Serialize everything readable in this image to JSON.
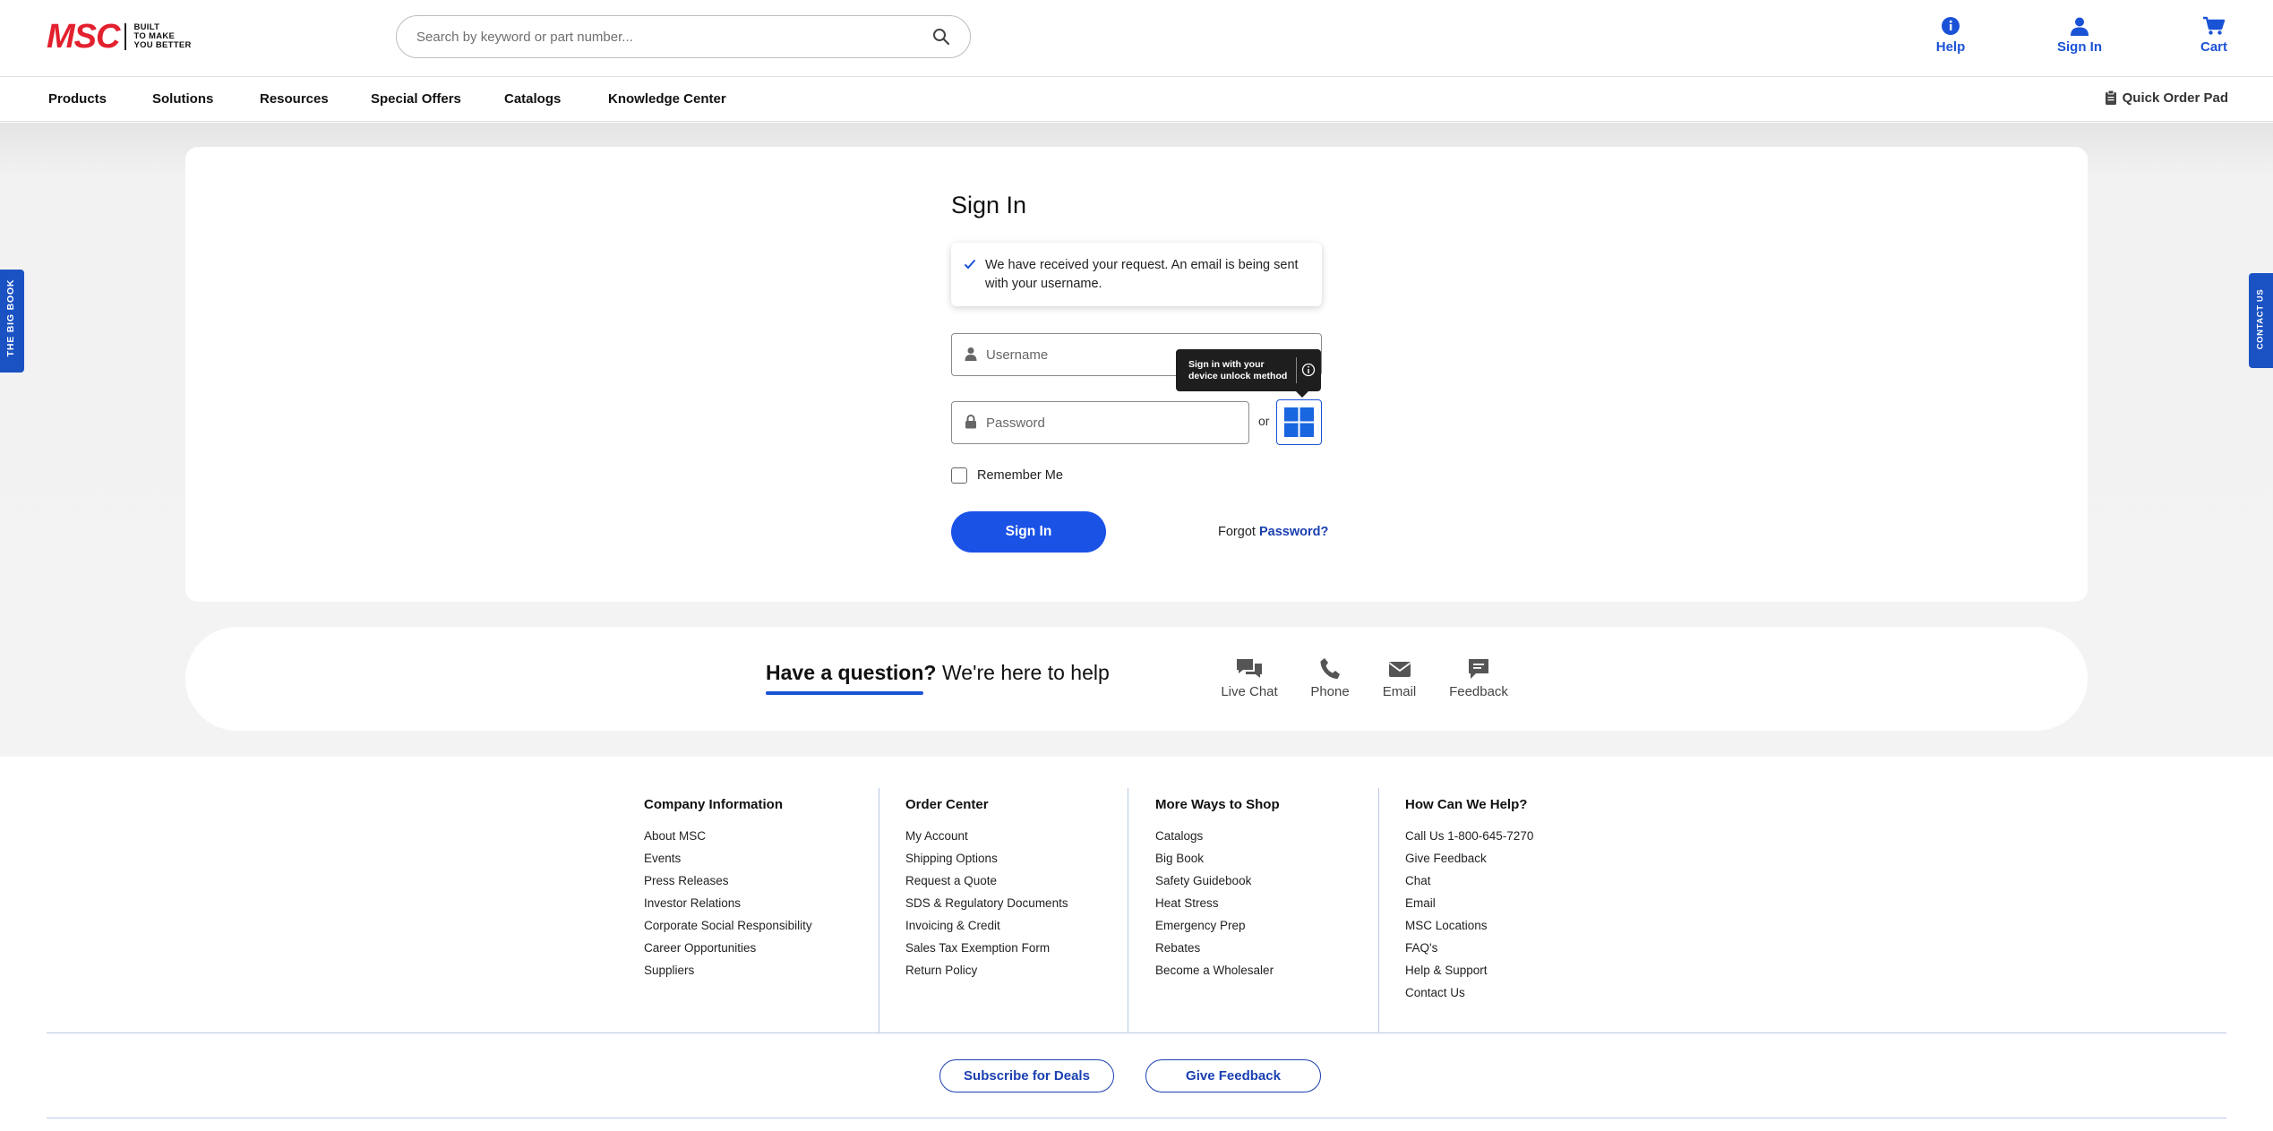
{
  "brand": {
    "name": "MSC",
    "tagline": [
      "BUILT",
      "TO MAKE",
      "YOU BETTER"
    ],
    "accent": "#1a52d6",
    "logo_red": "#e3202e"
  },
  "search": {
    "placeholder": "Search by keyword or part number..."
  },
  "header_actions": {
    "help": "Help",
    "sign_in": "Sign In",
    "cart": "Cart"
  },
  "nav": {
    "items": [
      "Products",
      "Solutions",
      "Resources",
      "Special Offers",
      "Catalogs",
      "Knowledge Center"
    ],
    "quick_order": "Quick Order Pad"
  },
  "signin": {
    "title": "Sign In",
    "alert": "We have received your request. An email is being sent with your username.",
    "username_placeholder": "Username",
    "password_placeholder": "Password",
    "or": "or",
    "tooltip": "Sign in with your device unlock method",
    "remember": "Remember Me",
    "button": "Sign In",
    "forgot_prefix": "Forgot",
    "forgot_link": "Password?"
  },
  "help_band": {
    "heading": "Have a question?",
    "subheading": "We're here to help",
    "options": [
      "Live Chat",
      "Phone",
      "Email",
      "Feedback"
    ]
  },
  "footer": {
    "columns": [
      {
        "title": "Company Information",
        "links": [
          "About MSC",
          "Events",
          "Press Releases",
          "Investor Relations",
          "Corporate Social Responsibility",
          "Career Opportunities",
          "Suppliers"
        ]
      },
      {
        "title": "Order Center",
        "links": [
          "My Account",
          "Shipping Options",
          "Request a Quote",
          "SDS & Regulatory Documents",
          "Invoicing & Credit",
          "Sales Tax Exemption Form",
          "Return Policy"
        ]
      },
      {
        "title": "More Ways to Shop",
        "links": [
          "Catalogs",
          "Big Book",
          "Safety Guidebook",
          "Heat Stress",
          "Emergency Prep",
          "Rebates",
          "Become a Wholesaler"
        ]
      },
      {
        "title": "How Can We Help?",
        "links": [
          "Call Us 1-800-645-7270",
          "Give Feedback",
          "Chat",
          "Email",
          "MSC Locations",
          "FAQ's",
          "Help & Support",
          "Contact Us"
        ]
      }
    ],
    "subscribe": "Subscribe for Deals",
    "feedback": "Give Feedback"
  },
  "side_tabs": {
    "left": "THE BIG BOOK",
    "right": "CONTACT US"
  }
}
